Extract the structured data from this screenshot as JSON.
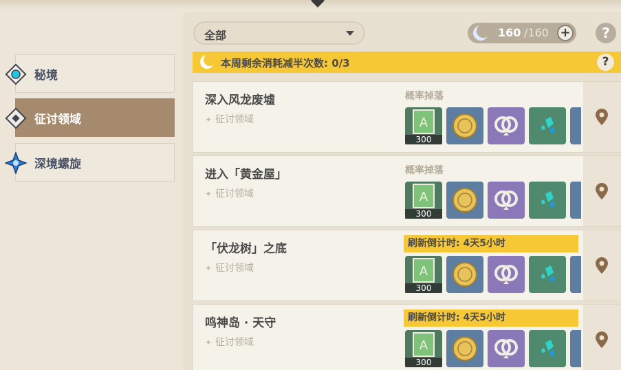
{
  "nav": {
    "items": [
      {
        "label": "秘境",
        "active": false
      },
      {
        "label": "征讨领域",
        "active": true
      },
      {
        "label": "深境螺旋",
        "active": false
      }
    ]
  },
  "filter": {
    "selected": "全部"
  },
  "resin": {
    "current": "160",
    "max": "/160"
  },
  "banner": {
    "text": "本周剩余消耗减半次数: 0/3"
  },
  "help_symbol": "?",
  "plus_symbol": "+",
  "domain_type": "征讨领域",
  "cards": [
    {
      "name": "深入风龙废墟",
      "drop_label": "概率掉落",
      "timer": ""
    },
    {
      "name": "进入「黄金屋」",
      "drop_label": "概率掉落",
      "timer": ""
    },
    {
      "name": "「伏龙树」之底",
      "drop_label": "",
      "timer": "刷新倒计时: 4天5小时"
    },
    {
      "name": "鸣神岛 · 天守",
      "drop_label": "",
      "timer": "刷新倒计时: 4天5小时"
    }
  ],
  "reward_qty": "300",
  "reward_icons": [
    "adventure-exp-book-icon",
    "mora-coin-icon",
    "companionship-exp-icon",
    "gemstone-icon"
  ],
  "colors": {
    "accent": "#f7c836",
    "active_nav": "#a58a6e",
    "background": "#ece5d8"
  }
}
